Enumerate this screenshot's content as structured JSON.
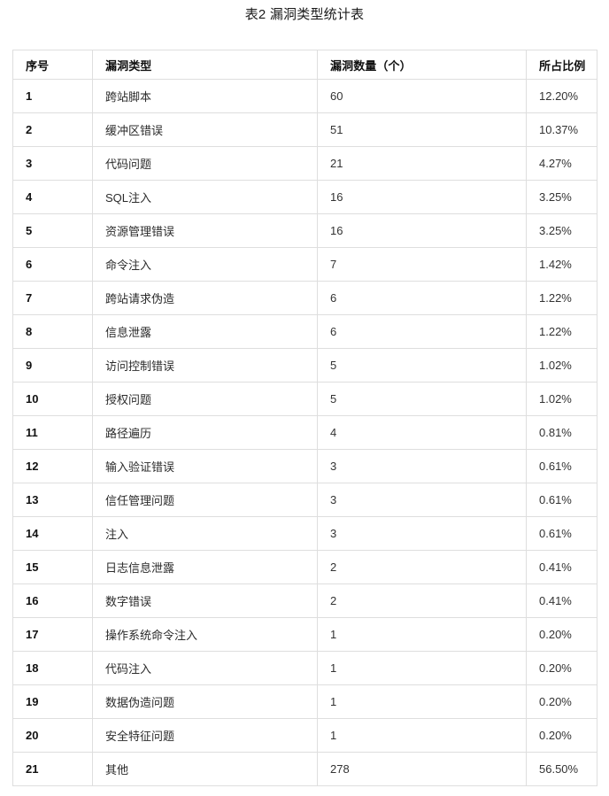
{
  "caption": "表2 漏洞类型统计表",
  "table": {
    "columns": [
      {
        "key": "index",
        "label": "序号"
      },
      {
        "key": "type",
        "label": "漏洞类型"
      },
      {
        "key": "count",
        "label": "漏洞数量（个）"
      },
      {
        "key": "pct",
        "label": "所占比例"
      }
    ],
    "rows": [
      {
        "index": "1",
        "type": "跨站脚本",
        "count": "60",
        "pct": "12.20%"
      },
      {
        "index": "2",
        "type": "缓冲区错误",
        "count": "51",
        "pct": "10.37%"
      },
      {
        "index": "3",
        "type": "代码问题",
        "count": "21",
        "pct": "4.27%"
      },
      {
        "index": "4",
        "type": "SQL注入",
        "count": "16",
        "pct": "3.25%"
      },
      {
        "index": "5",
        "type": "资源管理错误",
        "count": "16",
        "pct": "3.25%"
      },
      {
        "index": "6",
        "type": "命令注入",
        "count": "7",
        "pct": "1.42%"
      },
      {
        "index": "7",
        "type": "跨站请求伪造",
        "count": "6",
        "pct": "1.22%"
      },
      {
        "index": "8",
        "type": "信息泄露",
        "count": "6",
        "pct": "1.22%"
      },
      {
        "index": "9",
        "type": "访问控制错误",
        "count": "5",
        "pct": "1.02%"
      },
      {
        "index": "10",
        "type": "授权问题",
        "count": "5",
        "pct": "1.02%"
      },
      {
        "index": "11",
        "type": "路径遍历",
        "count": "4",
        "pct": "0.81%"
      },
      {
        "index": "12",
        "type": "输入验证错误",
        "count": "3",
        "pct": "0.61%"
      },
      {
        "index": "13",
        "type": "信任管理问题",
        "count": "3",
        "pct": "0.61%"
      },
      {
        "index": "14",
        "type": "注入",
        "count": "3",
        "pct": "0.61%"
      },
      {
        "index": "15",
        "type": "日志信息泄露",
        "count": "2",
        "pct": "0.41%"
      },
      {
        "index": "16",
        "type": "数字错误",
        "count": "2",
        "pct": "0.41%"
      },
      {
        "index": "17",
        "type": "操作系统命令注入",
        "count": "1",
        "pct": "0.20%"
      },
      {
        "index": "18",
        "type": "代码注入",
        "count": "1",
        "pct": "0.20%"
      },
      {
        "index": "19",
        "type": "数据伪造问题",
        "count": "1",
        "pct": "0.20%"
      },
      {
        "index": "20",
        "type": "安全特征问题",
        "count": "1",
        "pct": "0.20%"
      },
      {
        "index": "21",
        "type": "其他",
        "count": "278",
        "pct": "56.50%"
      }
    ]
  },
  "chart_data": {
    "type": "table",
    "title": "表2 漏洞类型统计表",
    "columns": [
      "序号",
      "漏洞类型",
      "漏洞数量（个）",
      "所占比例"
    ],
    "categories": [
      "跨站脚本",
      "缓冲区错误",
      "代码问题",
      "SQL注入",
      "资源管理错误",
      "命令注入",
      "跨站请求伪造",
      "信息泄露",
      "访问控制错误",
      "授权问题",
      "路径遍历",
      "输入验证错误",
      "信任管理问题",
      "注入",
      "日志信息泄露",
      "数字错误",
      "操作系统命令注入",
      "代码注入",
      "数据伪造问题",
      "安全特征问题",
      "其他"
    ],
    "series": [
      {
        "name": "漏洞数量（个）",
        "values": [
          60,
          51,
          21,
          16,
          16,
          7,
          6,
          6,
          5,
          5,
          4,
          3,
          3,
          3,
          2,
          2,
          1,
          1,
          1,
          1,
          278
        ]
      },
      {
        "name": "所占比例",
        "values": [
          12.2,
          10.37,
          4.27,
          3.25,
          3.25,
          1.42,
          1.22,
          1.22,
          1.02,
          1.02,
          0.81,
          0.61,
          0.61,
          0.61,
          0.41,
          0.41,
          0.2,
          0.2,
          0.2,
          0.2,
          56.5
        ]
      }
    ],
    "xlabel": "漏洞类型",
    "ylabel": "漏洞数量（个）",
    "grid": true,
    "legend": "none"
  }
}
